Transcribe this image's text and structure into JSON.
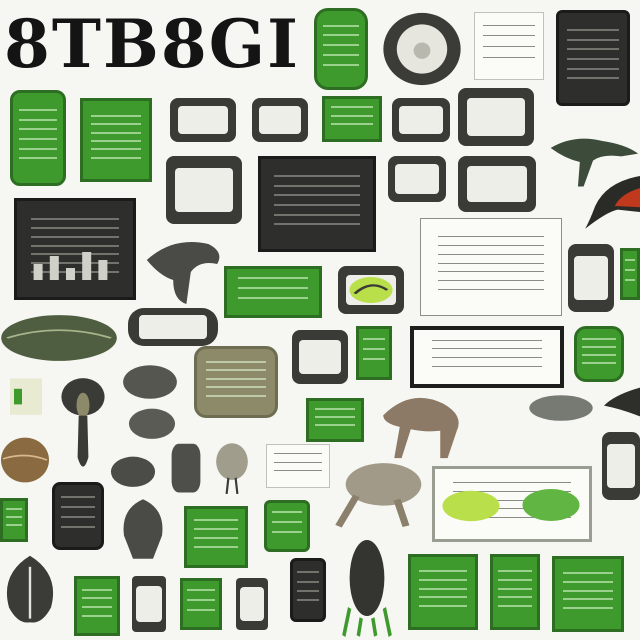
{
  "title": "8TB8GI",
  "colors": {
    "background": "#f6f7f3",
    "green": "#3f9a2e",
    "dark": "#2e2f2c",
    "olive": "#8c8a68",
    "accent_red": "#c0391d",
    "accent_lime": "#b9e04a"
  },
  "icons": [
    "leaf-icon",
    "animal-figure-icon",
    "bird-head-icon",
    "bar-chart-icon",
    "stone-icon",
    "seed-icon",
    "alien-figure-icon",
    "animal-skull-icon"
  ]
}
